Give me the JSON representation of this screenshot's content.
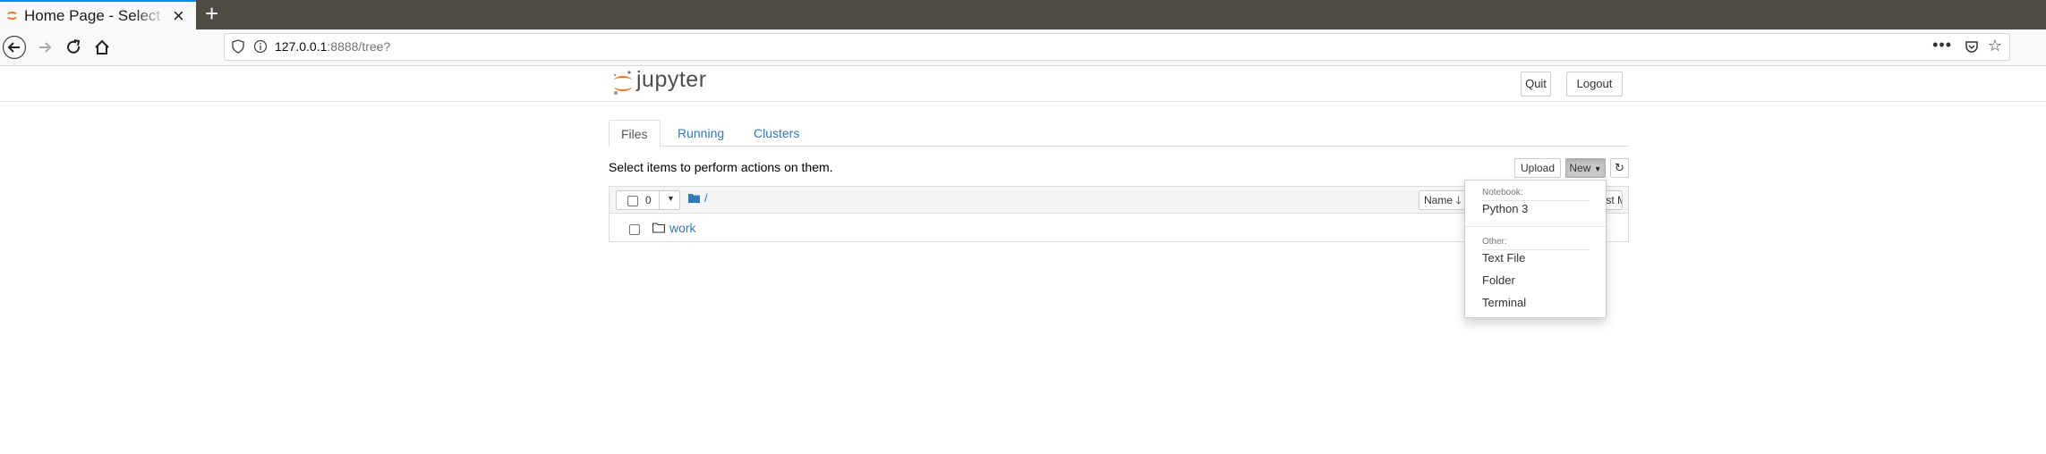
{
  "browser": {
    "tab_title": "Home Page - Select or create a notebook",
    "url_host": "127.0.0.1",
    "url_rest": ":8888/tree?"
  },
  "header": {
    "logo_text": "jupyter",
    "quit_label": "Quit",
    "logout_label": "Logout"
  },
  "tabs": [
    {
      "label": "Files"
    },
    {
      "label": "Running"
    },
    {
      "label": "Clusters"
    }
  ],
  "toolbar": {
    "hint": "Select items to perform actions on them.",
    "upload_label": "Upload",
    "new_label": "New"
  },
  "list": {
    "selected_count": "0",
    "breadcrumb": "/",
    "name_header": "Name",
    "last_modified_header": "Last Modified",
    "items": [
      {
        "name": "work"
      }
    ]
  },
  "new_menu": {
    "notebook_header": "Notebook:",
    "python3": "Python 3",
    "other_header": "Other:",
    "text_file": "Text File",
    "folder": "Folder",
    "terminal": "Terminal"
  },
  "colors": {
    "link": "#337ab7",
    "tabbar": "#504b45",
    "jupyter_orange": "#f37726"
  }
}
